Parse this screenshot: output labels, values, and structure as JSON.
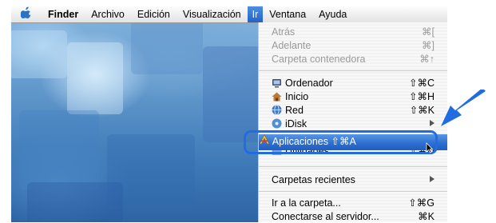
{
  "menubar": {
    "apple_icon": "apple-icon",
    "items": [
      "Finder",
      "Archivo",
      "Edición",
      "Visualización",
      "Ir",
      "Ventana",
      "Ayuda"
    ],
    "active_index": 4
  },
  "go_menu": {
    "group1": [
      {
        "label": "Atrás",
        "shortcut": "⌘[",
        "enabled": false
      },
      {
        "label": "Adelante",
        "shortcut": "⌘]",
        "enabled": false
      },
      {
        "label": "Carpeta contenedora",
        "shortcut": "⌘↑",
        "enabled": false
      }
    ],
    "group2": [
      {
        "label": "Ordenador",
        "shortcut": "⇧⌘C",
        "icon": "computer-icon"
      },
      {
        "label": "Inicio",
        "shortcut": "⇧⌘H",
        "icon": "home-icon"
      },
      {
        "label": "Red",
        "shortcut": "⇧⌘K",
        "icon": "network-icon"
      },
      {
        "label": "iDisk",
        "shortcut": "",
        "icon": "idisk-icon",
        "submenu": true
      },
      {
        "label": "Aplicaciones",
        "shortcut": "⇧⌘A",
        "icon": "applications-icon",
        "highlighted": true
      },
      {
        "label": "Utilidades",
        "shortcut": "⇧⌘U",
        "icon": "utilities-icon"
      }
    ],
    "recent": {
      "label": "Carpetas recientes",
      "submenu": true
    },
    "group4": [
      {
        "label": "Ir a la carpeta...",
        "shortcut": "⇧⌘G"
      },
      {
        "label": "Conectarse al servidor...",
        "shortcut": "⌘K"
      }
    ]
  },
  "colors": {
    "highlight": "#2f6fd0",
    "callout_border": "#1f6de0",
    "arrow": "#1f6de0"
  }
}
